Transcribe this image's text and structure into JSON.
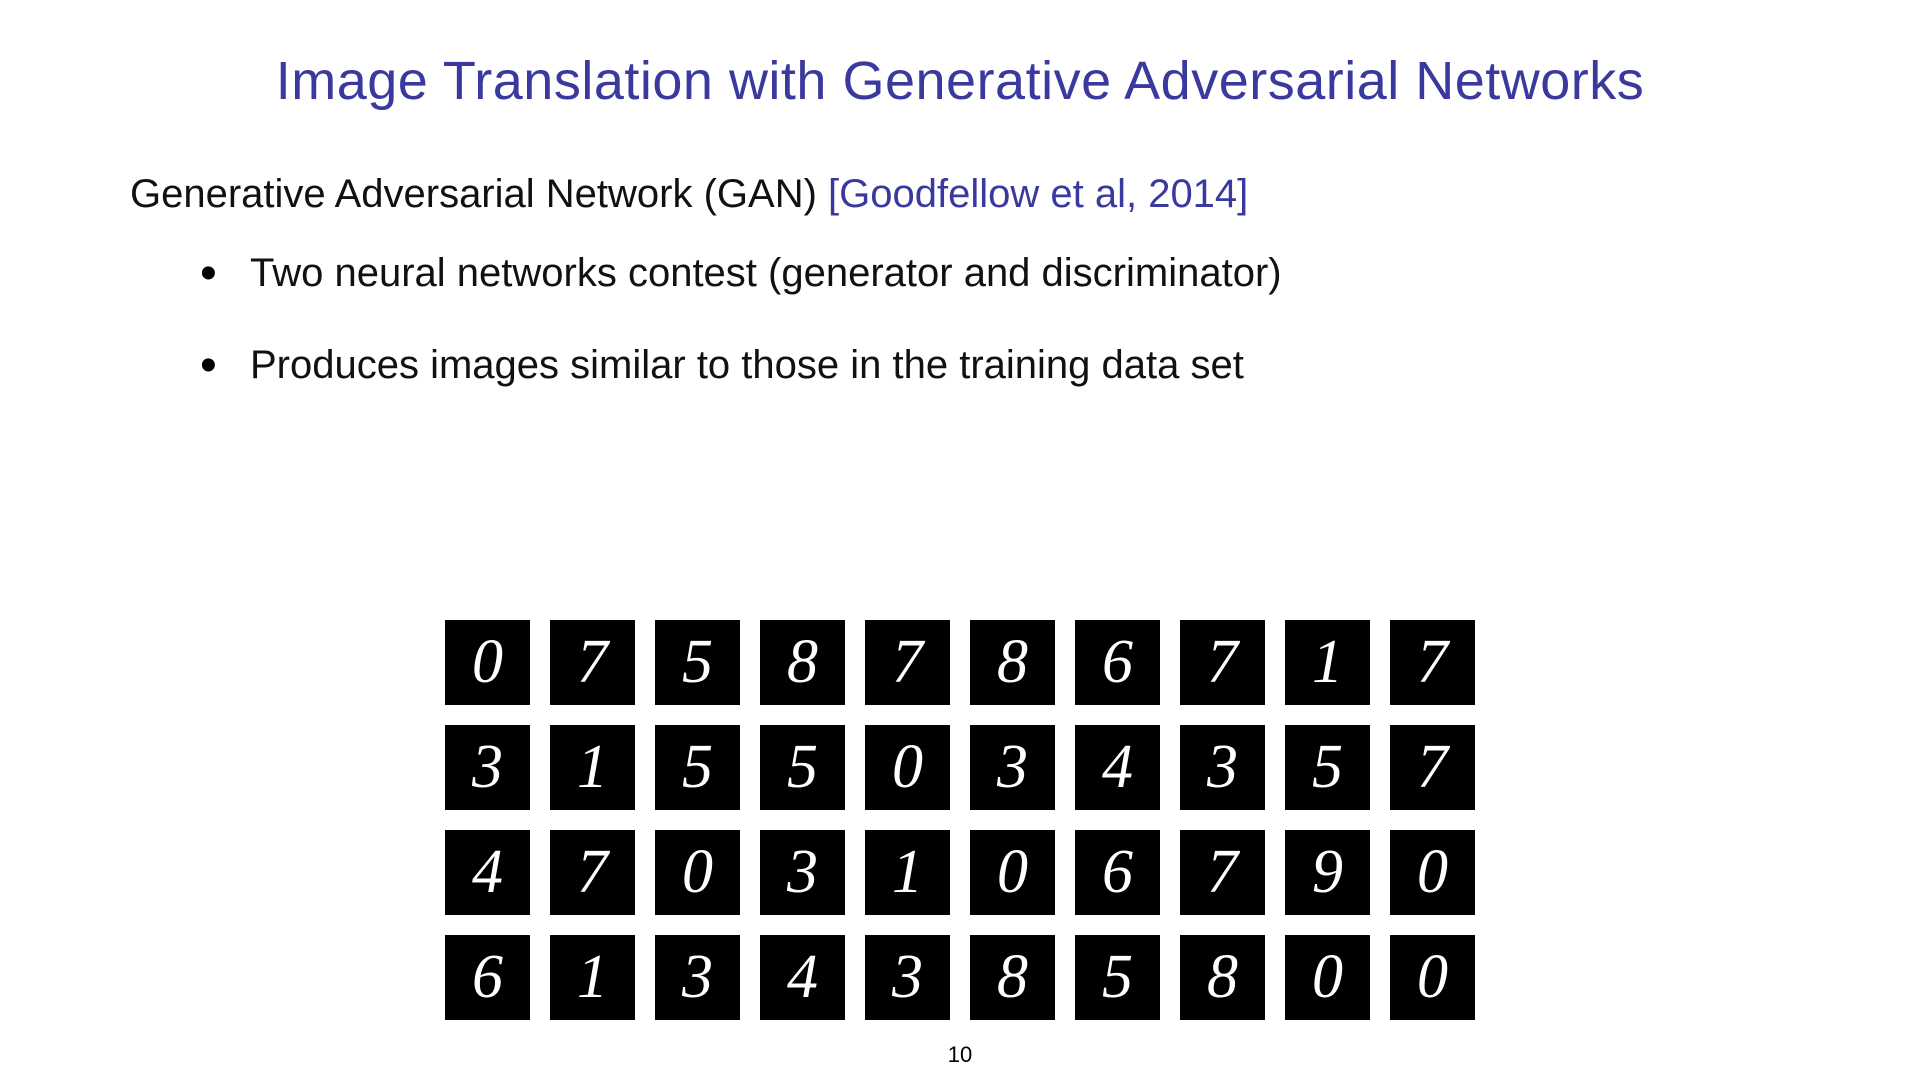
{
  "title": "Image Translation with Generative Adversarial Networks",
  "intro": {
    "text": "Generative Adversarial Network (GAN) ",
    "citation": "[Goodfellow et al, 2014]"
  },
  "bullets": [
    "Two neural networks contest (generator and discriminator)",
    "Produces images similar to those in the training data set"
  ],
  "digit_grid": [
    [
      "0",
      "7",
      "5",
      "8",
      "7",
      "8",
      "6",
      "7",
      "1",
      "7"
    ],
    [
      "3",
      "1",
      "5",
      "5",
      "0",
      "3",
      "4",
      "3",
      "5",
      "7"
    ],
    [
      "4",
      "7",
      "0",
      "3",
      "1",
      "0",
      "6",
      "7",
      "9",
      "0"
    ],
    [
      "6",
      "1",
      "3",
      "4",
      "3",
      "8",
      "5",
      "8",
      "0",
      "0"
    ]
  ],
  "page_number": "10"
}
